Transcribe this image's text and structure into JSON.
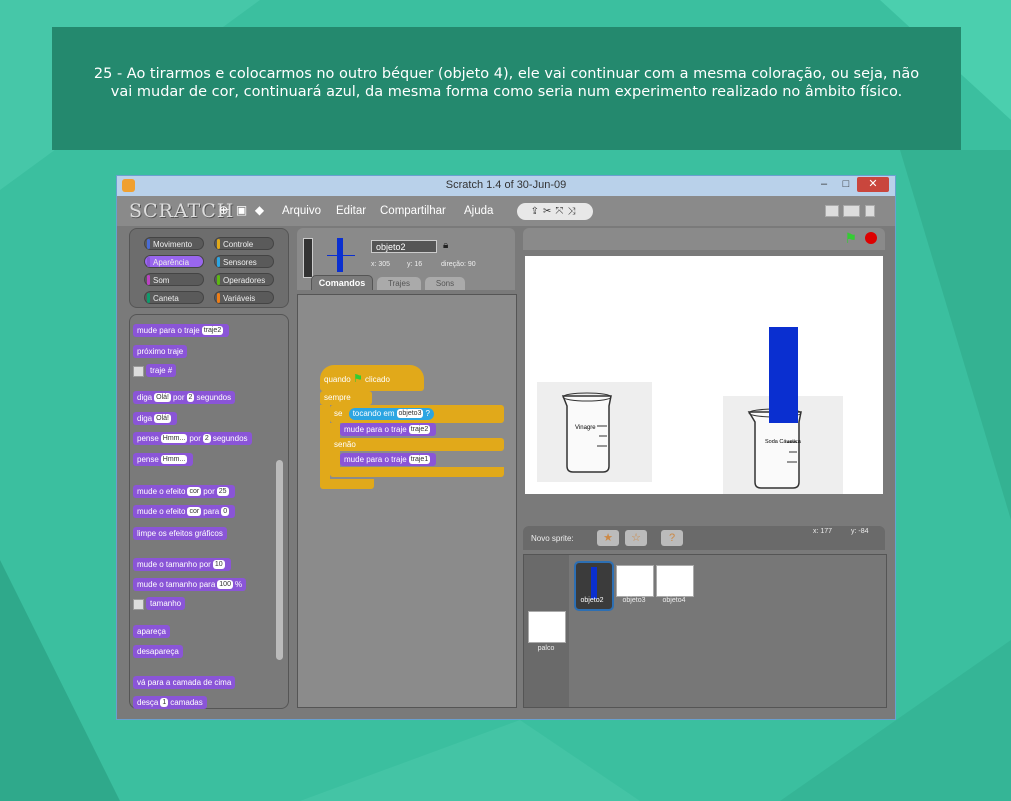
{
  "caption": {
    "text": "25 - Ao tirarmos e colocarmos no outro béquer (objeto 4), ele vai continuar com a mesma coloração, ou seja, não vai mudar de cor, continuará azul, da mesma forma como seria num experimento realizado no âmbito físico."
  },
  "window": {
    "title": "Scratch 1.4 of 30-Jun-09",
    "minimize": "–",
    "maximize": "□",
    "close": "✕"
  },
  "menubar": {
    "logo": "SCRATCH",
    "items": [
      "Arquivo",
      "Editar",
      "Compartilhar",
      "Ajuda"
    ]
  },
  "categories": [
    {
      "label": "Movimento",
      "color": "#4a6cd4"
    },
    {
      "label": "Controle",
      "color": "#e1a91a"
    },
    {
      "label": "Aparência",
      "color": "#8a55d7"
    },
    {
      "label": "Sensores",
      "color": "#2ca5e2"
    },
    {
      "label": "Som",
      "color": "#bb42c3"
    },
    {
      "label": "Operadores",
      "color": "#5cb712"
    },
    {
      "label": "Caneta",
      "color": "#0e9a6c"
    },
    {
      "label": "Variáveis",
      "color": "#ee7d16"
    }
  ],
  "palette": {
    "b1": "mude para o traje",
    "b1v": "traje2",
    "b2": "próximo traje",
    "b3": "traje #",
    "b4a": "diga",
    "b4v": "Olá!",
    "b4b": "por",
    "b4n": "2",
    "b4c": "segundos",
    "b5a": "diga",
    "b5v": "Olá!",
    "b6a": "pense",
    "b6v": "Hmm...",
    "b6b": "por",
    "b6n": "2",
    "b6c": "segundos",
    "b7a": "pense",
    "b7v": "Hmm...",
    "b8a": "mude o efeito",
    "b8v": "cor",
    "b8b": "por",
    "b8n": "25",
    "b9a": "mude o efeito",
    "b9v": "cor",
    "b9b": "para",
    "b9n": "0",
    "b10": "limpe os efeitos gráficos",
    "b11a": "mude o tamanho por",
    "b11n": "10",
    "b12a": "mude o tamanho para",
    "b12n": "100",
    "b12b": "%",
    "b13": "tamanho",
    "b14": "apareça",
    "b15": "desapareça",
    "b16": "vá para a camada de cima",
    "b17a": "desça",
    "b17n": "1",
    "b17b": "camadas"
  },
  "sprite_info": {
    "name": "objeto2",
    "x": "x: 305",
    "y": "y: 16",
    "dir": "direção: 90"
  },
  "tabs": [
    "Comandos",
    "Trajes",
    "Sons"
  ],
  "script": {
    "hat": "quando",
    "hat_tail": "clicado",
    "forever": "sempre",
    "if": "se",
    "touching": "tocando em",
    "touching_obj": "objeto3",
    "q": "?",
    "then_block": "mude para o traje",
    "then_val": "traje2",
    "else": "senão",
    "else_block": "mude para o traje",
    "else_val": "traje1"
  },
  "stage": {
    "beaker1_label": "Vinagre",
    "beaker2_label": "Soda Cáustica",
    "liquid_color": "#0a2fd0"
  },
  "sprite_bar": {
    "new_sprite": "Novo sprite:",
    "coords_x": "x: 177",
    "coords_y": "y: -84"
  },
  "sprites": [
    {
      "label": "objeto2"
    },
    {
      "label": "objeto3"
    },
    {
      "label": "objeto4"
    }
  ],
  "stage_thumb": {
    "label": "palco"
  }
}
